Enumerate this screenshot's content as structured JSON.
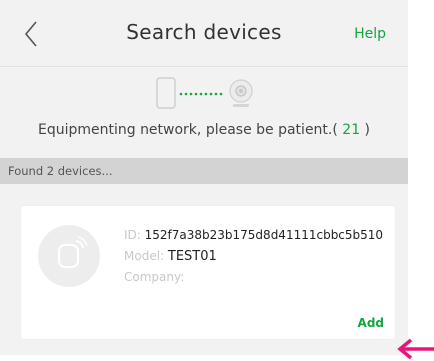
{
  "header": {
    "title": "Search devices",
    "help_label": "Help"
  },
  "status": {
    "message": "Equipmenting network, please be patient.( ",
    "count": "21",
    "close": " )"
  },
  "found": {
    "text": "Found 2 devices..."
  },
  "device": {
    "id_label": "ID: ",
    "id_value": "152f7a38b23b175d8d41111cbbc5b510",
    "model_label": "Model: ",
    "model_value": "TEST01",
    "company_label": "Company:",
    "company_value": "",
    "add_label": "Add"
  },
  "colors": {
    "accent": "#14a53d",
    "annotation_arrow": "#e8157a"
  }
}
